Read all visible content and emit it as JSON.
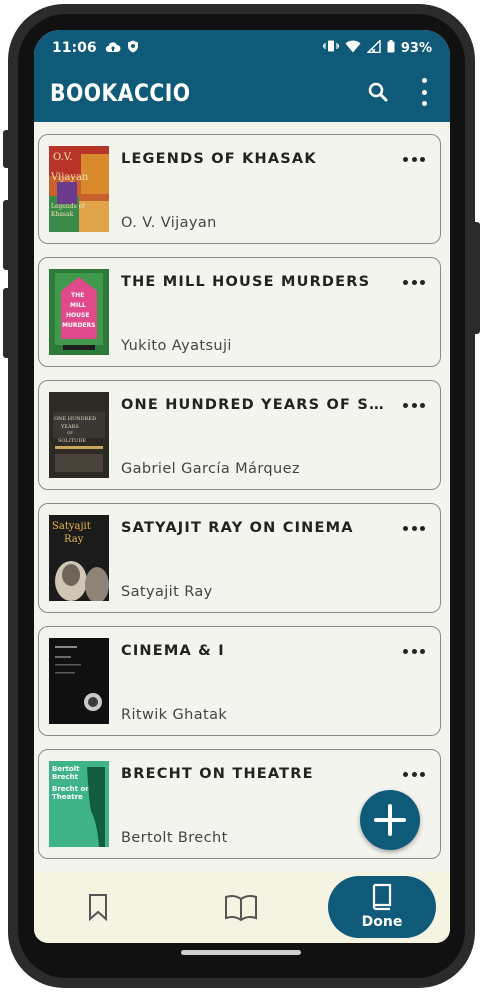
{
  "status_bar": {
    "time": "11:06",
    "battery": "93%",
    "left_icons": [
      "cloud-upload-icon",
      "shield-icon"
    ],
    "right_icons": [
      "vibrate-icon",
      "wifi-icon",
      "signal-icon",
      "battery-icon"
    ]
  },
  "app_bar": {
    "title": "BOOKACCIO",
    "actions": [
      "search-icon",
      "more-vert-icon"
    ]
  },
  "books": [
    {
      "title": "LEGENDS OF KHASAK",
      "author": "O. V. Vijayan",
      "cover_icon": "legends-of-khasak-cover"
    },
    {
      "title": "THE MILL HOUSE MURDERS",
      "author": "Yukito Ayatsuji",
      "cover_icon": "mill-house-murders-cover"
    },
    {
      "title": "ONE HUNDRED YEARS OF SOLITU...",
      "author": "Gabriel García Márquez",
      "cover_icon": "one-hundred-years-cover"
    },
    {
      "title": "SATYAJIT RAY ON CINEMA",
      "author": "Satyajit Ray",
      "cover_icon": "satyajit-ray-cover"
    },
    {
      "title": "CINEMA & I",
      "author": "Ritwik Ghatak",
      "cover_icon": "cinema-and-i-cover"
    },
    {
      "title": "BRECHT ON THEATRE",
      "author": "Bertolt Brecht",
      "cover_icon": "brecht-on-theatre-cover"
    }
  ],
  "fab": {
    "icon": "plus-icon"
  },
  "bottom_nav": {
    "items": [
      {
        "icon": "bookmark-icon",
        "label": "",
        "active": false
      },
      {
        "icon": "open-book-icon",
        "label": "",
        "active": false
      },
      {
        "icon": "book-icon",
        "label": "Done",
        "active": true
      }
    ]
  },
  "colors": {
    "primary": "#0e5a78",
    "background": "#f4f4ef",
    "nav_background": "#f5f3e2"
  }
}
